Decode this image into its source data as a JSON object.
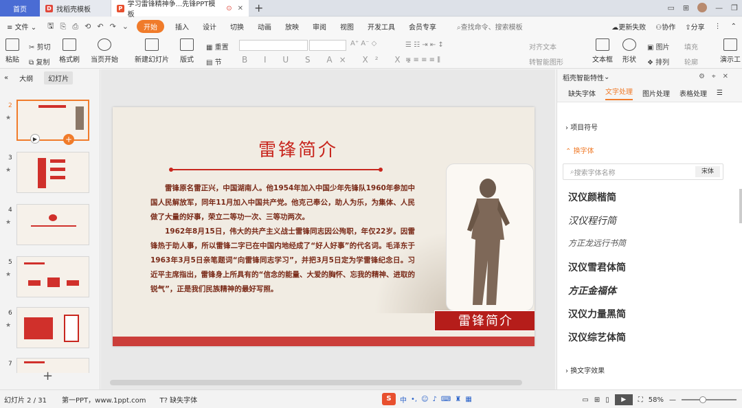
{
  "tabs": {
    "home": "首页",
    "find": "找稻壳模板",
    "doc": "学习雷锋精神争...先锋PPT模板"
  },
  "menu": {
    "file": "文件",
    "items": [
      "开始",
      "插入",
      "设计",
      "切换",
      "动画",
      "放映",
      "审阅",
      "视图",
      "开发工具",
      "会员专享"
    ],
    "search": "查找命令、搜索模板",
    "right": [
      "更新失败",
      "协作",
      "分享"
    ]
  },
  "ribbon": {
    "paste": "粘贴",
    "cut": "剪切",
    "copy": "复制",
    "format_painter": "格式刷",
    "from_current": "当页开始",
    "new_slide": "新建幻灯片",
    "layout": "版式",
    "section": "节",
    "reset": "重置",
    "align": "对齐文本",
    "to_smartart": "转智能图形",
    "textbox": "文本框",
    "shape": "形状",
    "arrange": "排列",
    "picture": "图片",
    "fill": "填充",
    "outline": "轮廓",
    "present": "演示工"
  },
  "leftpane": {
    "tabs": [
      "大纲",
      "幻灯片"
    ],
    "thumbs": [
      {
        "num": "2"
      },
      {
        "num": "3"
      },
      {
        "num": "4"
      },
      {
        "num": "5"
      },
      {
        "num": "6"
      },
      {
        "num": "7"
      }
    ]
  },
  "slide": {
    "title": "雷锋简介",
    "paragraph1": "雷锋原名雷正兴，中国湖南人。他1954年加入中国少年先锋队1960年参加中国人民解放军，同年11月加入中国共产党。他克己奉公，助人为乐，为集体、人民做了大量的好事，荣立二等功一次、三等功两次。",
    "paragraph2": "1962年8月15日，伟大的共产主义战士雷锋同志因公殉职，年仅22岁。因雷锋热于助人事，所以雷锋二字已在中国内地经成了“好人好事”的代名词。毛泽东于1963年3月5日亲笔题词“向雷锋同志学习”，并把3月5日定为学雷锋纪念日。习近平主席指出，雷锋身上所具有的“信念的能量、大爱的胸怀、忘我的精神、进取的锐气”，正是我们民族精神的最好写照。",
    "caption": "雷锋简介"
  },
  "rightpane": {
    "header": "稻壳智能特性",
    "tabs": [
      "缺失字体",
      "文字处理",
      "图片处理",
      "表格处理"
    ],
    "bullet_section": "项目符号",
    "font_section": "换字体",
    "search_placeholder": "搜索字体名称",
    "current_font": "宋体",
    "fonts": [
      "汉仪颜楷简",
      "汉仪程行简",
      "方正龙远行书简",
      "汉仪雪君体简",
      "方正金福体",
      "汉仪力量黑简",
      "汉仪综艺体简"
    ],
    "effects_section": "换文字效果"
  },
  "status": {
    "slide_pos": "幻灯片 2 / 31",
    "theme": "第一PPT，www.1ppt.com",
    "missing_font": "缺失字体",
    "zoom": "58%"
  },
  "colors": {
    "accent": "#f07b2a",
    "title_red": "#c8261e",
    "home_blue": "#4a6cd4"
  }
}
